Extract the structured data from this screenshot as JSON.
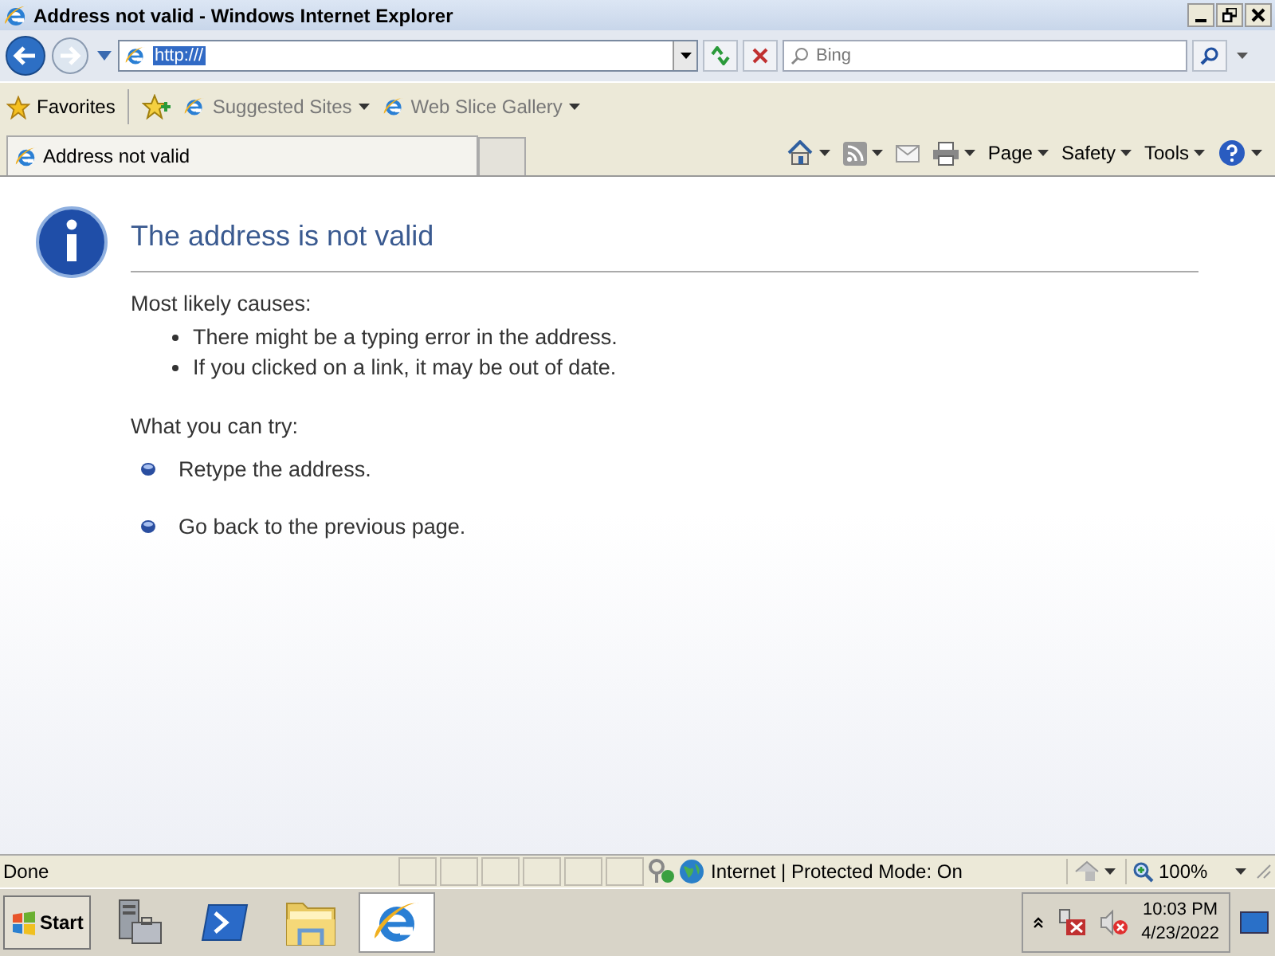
{
  "window": {
    "title": "Address not valid - Windows Internet Explorer"
  },
  "address": {
    "value": "http:///"
  },
  "search": {
    "placeholder": "Bing"
  },
  "favorites_bar": {
    "label": "Favorites",
    "items": [
      {
        "label": "Suggested Sites"
      },
      {
        "label": "Web Slice Gallery"
      }
    ]
  },
  "tabs": [
    {
      "label": "Address not valid",
      "selected": true
    }
  ],
  "command_bar": [
    "Page",
    "Safety",
    "Tools"
  ],
  "page": {
    "heading": "The address is not valid",
    "causes_label": "Most likely causes:",
    "causes": [
      "There might be a typing error in the address.",
      "If you clicked on a link, it may be out of date."
    ],
    "try_label": "What you can try:",
    "tries": [
      "Retype the address.",
      "Go back to the previous page."
    ]
  },
  "status_bar": {
    "text": "Done",
    "zone": "Internet | Protected Mode: On",
    "zoom": "100%"
  },
  "taskbar": {
    "start": "Start",
    "apps": [
      {
        "kind": "server",
        "selected": false
      },
      {
        "kind": "shell",
        "selected": false
      },
      {
        "kind": "folder",
        "selected": false
      },
      {
        "kind": "browser",
        "selected": true
      }
    ],
    "time": "10:03 PM",
    "date": "4/23/2022"
  }
}
